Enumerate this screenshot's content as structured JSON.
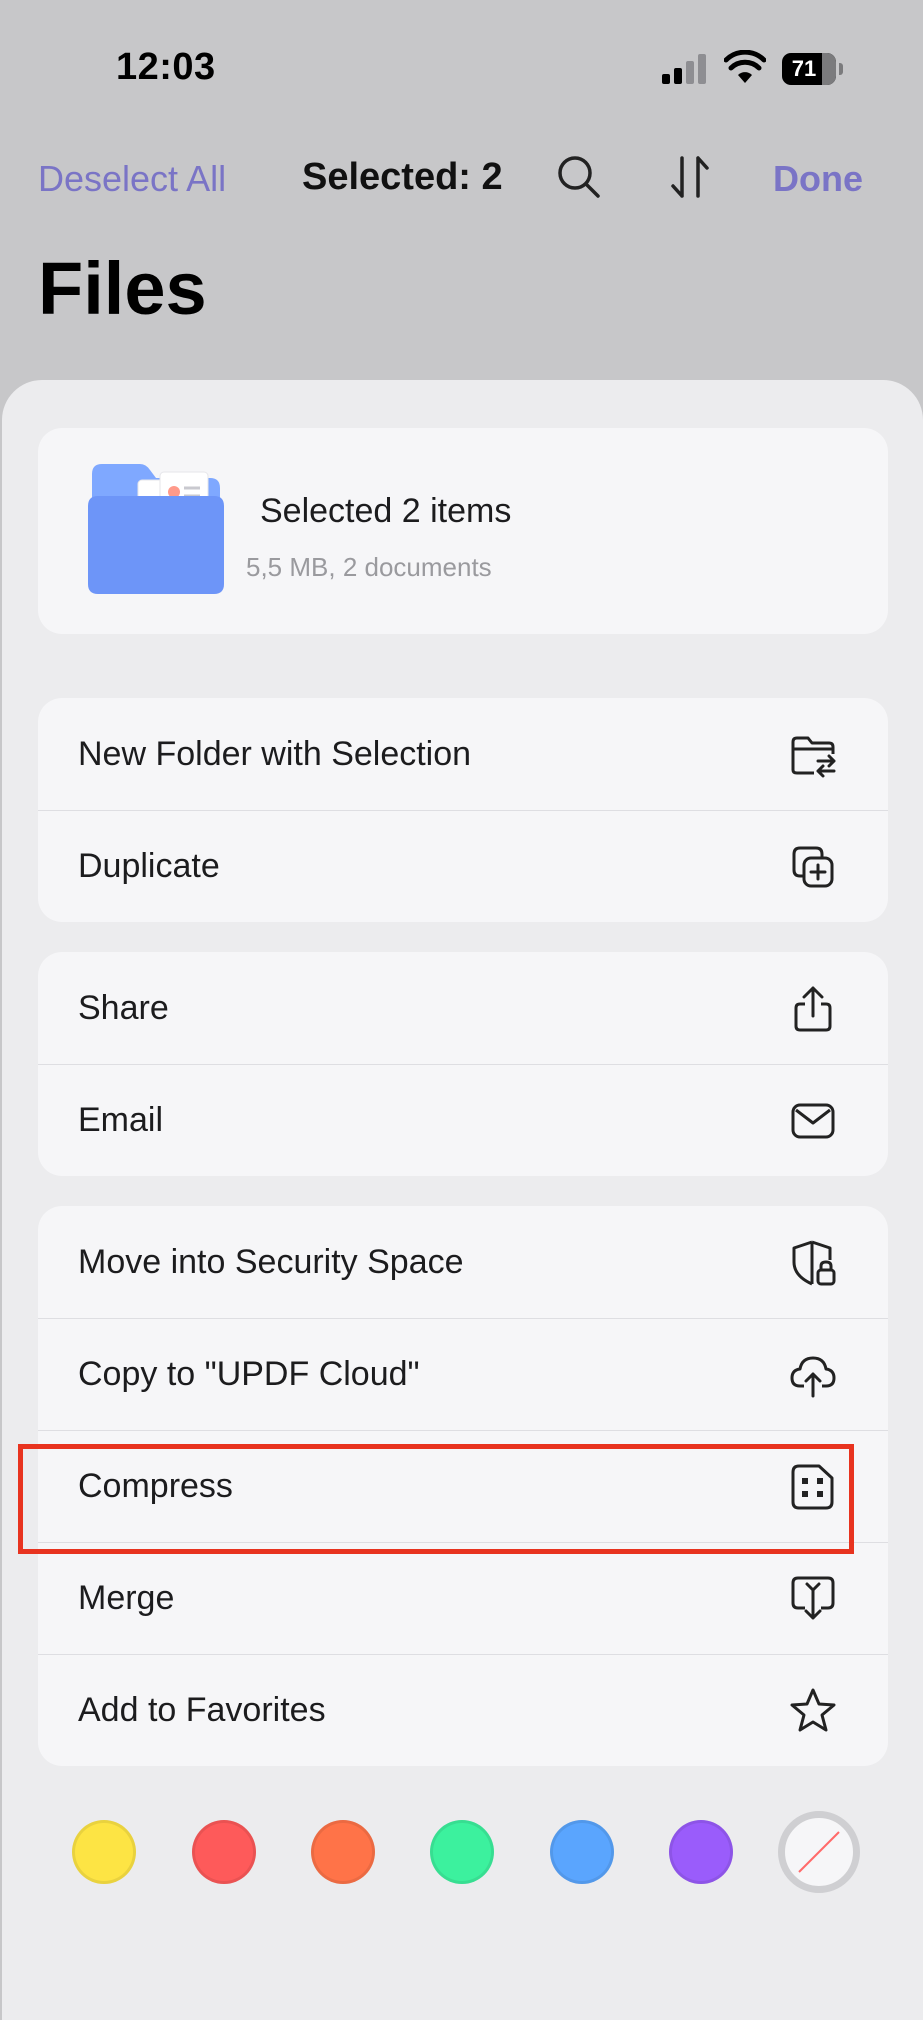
{
  "status": {
    "time": "12:03",
    "battery": "71"
  },
  "nav": {
    "deselect_label": "Deselect All",
    "selected_label": "Selected: 2",
    "done_label": "Done"
  },
  "page": {
    "title": "Files"
  },
  "summary": {
    "title": "Selected 2 items",
    "subtitle": "5,5 MB, 2 documents"
  },
  "groups": [
    [
      {
        "label": "New Folder with Selection",
        "icon": "new-folder-icon"
      },
      {
        "label": "Duplicate",
        "icon": "duplicate-icon"
      }
    ],
    [
      {
        "label": "Share",
        "icon": "share-icon"
      },
      {
        "label": "Email",
        "icon": "mail-icon"
      }
    ],
    [
      {
        "label": "Move into Security Space",
        "icon": "shield-lock-icon"
      },
      {
        "label": "Copy to \"UPDF Cloud\"",
        "icon": "cloud-upload-icon"
      },
      {
        "label": "Compress",
        "icon": "compress-icon"
      },
      {
        "label": "Merge",
        "icon": "merge-icon"
      },
      {
        "label": "Add to Favorites",
        "icon": "star-icon"
      }
    ]
  ],
  "colors": {
    "accent": "#7a74c6",
    "highlight_border": "#e8331f",
    "tags": [
      "#fde444",
      "#fe5a5a",
      "#ff7348",
      "#3cf19e",
      "#5aa5fe",
      "#9a5cfb"
    ]
  }
}
